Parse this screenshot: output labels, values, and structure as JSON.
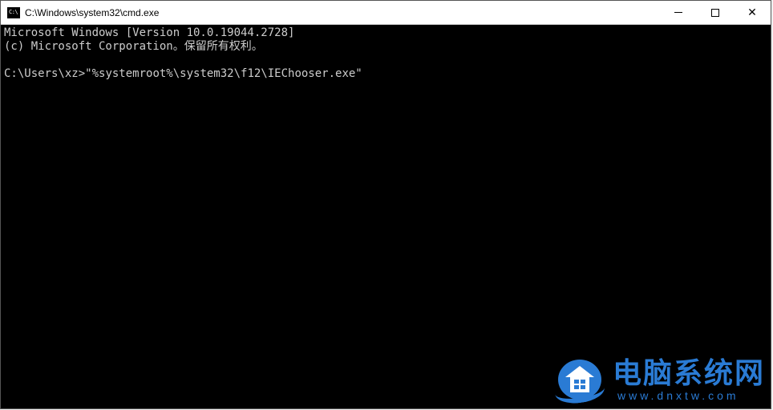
{
  "titlebar": {
    "icon_label": "C:\\",
    "title": "C:\\Windows\\system32\\cmd.exe"
  },
  "terminal": {
    "line1": "Microsoft Windows [Version 10.0.19044.2728]",
    "line2": "(c) Microsoft Corporation。保留所有权利。",
    "blank": "",
    "prompt": "C:\\Users\\xz>",
    "command": "\"%systemroot%\\system32\\f12\\IEChooser.exe\""
  },
  "watermark": {
    "name_cn": "电脑系统网",
    "url": "www.dnxtw.com"
  }
}
